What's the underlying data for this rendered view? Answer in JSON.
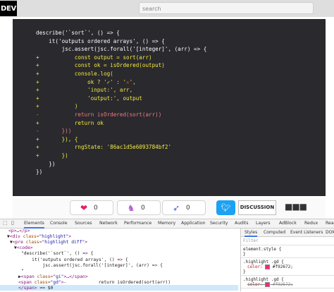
{
  "header": {
    "logo": "DEV",
    "search_placeholder": "search"
  },
  "code": {
    "lines": [
      {
        "type": "ctx",
        "marker": "",
        "text": "describe('`sort`', () => {"
      },
      {
        "type": "ctx",
        "marker": "",
        "text": "    it('outputs ordered arrays', () => {"
      },
      {
        "type": "ctx",
        "marker": "",
        "text": "        jsc.assert(jsc.forall('[integer]', (arr) => {"
      },
      {
        "type": "add",
        "marker": "+",
        "text": "            const output = sort(arr)"
      },
      {
        "type": "add",
        "marker": "+",
        "text": "            const ok = isOrdered(output)"
      },
      {
        "type": "add",
        "marker": "+",
        "text": "            console.log("
      },
      {
        "type": "add",
        "marker": "+",
        "text": "                ok ? '✓' : '",
        "x_mark": "✕",
        "after": "',"
      },
      {
        "type": "add",
        "marker": "+",
        "text": "                'input:', arr,"
      },
      {
        "type": "add",
        "marker": "+",
        "text": "                'output:', output"
      },
      {
        "type": "add",
        "marker": "+",
        "text": "            )"
      },
      {
        "type": "del",
        "marker": "-",
        "text": "            return isOrdered(sort(arr))"
      },
      {
        "type": "add",
        "marker": "+",
        "text": "            return ok"
      },
      {
        "type": "del",
        "marker": "-",
        "text": "        }))"
      },
      {
        "type": "add",
        "marker": "+",
        "text": "        }), {"
      },
      {
        "type": "add",
        "marker": "+",
        "text": "            rngState: '86ac1d5e6093784bf2'"
      },
      {
        "type": "add",
        "marker": "+",
        "text": "        })"
      },
      {
        "type": "ctx",
        "marker": "",
        "text": "    })"
      },
      {
        "type": "ctx",
        "marker": "",
        "text": "})"
      }
    ]
  },
  "reactions": {
    "like": {
      "icon": "heart-icon",
      "count": "0"
    },
    "unicorn": {
      "icon": "unicorn-icon",
      "count": "0"
    },
    "bookmark": {
      "icon": "rocket-icon",
      "count": "0"
    },
    "twitter_icon": "twitter-icon",
    "discussion_label": "DISCUSSION",
    "more_label": "■■■"
  },
  "devtools": {
    "tabs": [
      "Elements",
      "Console",
      "Sources",
      "Network",
      "Performance",
      "Memory",
      "Application",
      "Security",
      "Audits",
      "Layers",
      "AdBlock",
      "Redux",
      "React"
    ],
    "elements_lines": [
      {
        "indent": 12,
        "text": "<p>…</p>"
      },
      {
        "indent": 10,
        "text": "▼<div class=\"highlight\">"
      },
      {
        "indent": 14,
        "text": "▼<pre class=\"highlight diff\">"
      },
      {
        "indent": 20,
        "text": "▼<code>"
      },
      {
        "indent": 30,
        "text": "\"describe('`sort`', () => {"
      },
      {
        "indent": 30,
        "text": "    it('outputs ordered arrays', () => {"
      },
      {
        "indent": 30,
        "text": "        jsc.assert(jsc.forall('[integer]', (arr) => {"
      },
      {
        "indent": 30,
        "text": "\""
      },
      {
        "indent": 26,
        "text": "▶<span class=\"gi\">…</span>"
      },
      {
        "indent": 26,
        "text": "<span class=\"gd\">-            return isOrdered(sort(arr))"
      },
      {
        "indent": 26,
        "text": "</span> == $0"
      }
    ],
    "styles_tabs": [
      "Styles",
      "Computed",
      "Event Listeners",
      "DOM"
    ],
    "filter_placeholder": "Filter",
    "styles_rules": [
      {
        "selector": "element.style {",
        "decl": "",
        "close": "}"
      },
      {
        "selector": ".highlight .gd {",
        "decl": "color: #f92672;",
        "close": "}"
      },
      {
        "selector": ".highlight .gd {",
        "decl": "color: #f92672;",
        "close": ""
      }
    ],
    "accent": "#3b78e7"
  }
}
